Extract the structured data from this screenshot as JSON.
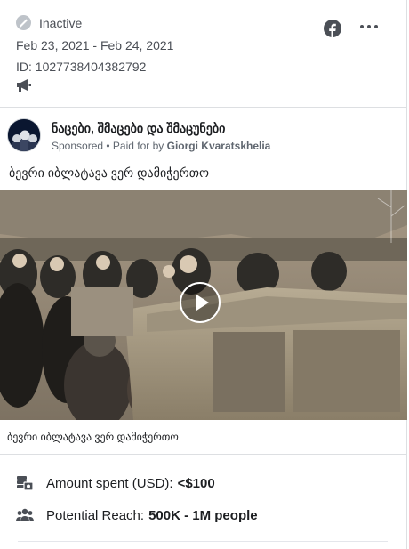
{
  "header": {
    "status": "Inactive",
    "dates": "Feb 23, 2021 - Feb 24, 2021",
    "id_label": "ID: 1027738404382792",
    "platform_icon": "facebook-icon",
    "more_icon": "more-icon"
  },
  "page": {
    "name": "ნაცები, შმაცები და შმაცუნები",
    "sponsored": "Sponsored",
    "paid_for_prefix": " • Paid for by ",
    "paid_for_by": "Giorgi Kvaratskhelia",
    "ad_text": "ბევრი იბლატავა ვერ დამიჭერთო"
  },
  "video": {
    "caption": "ბევრი იბლატავა ვერ დამიჭერთო",
    "play_icon": "play-icon"
  },
  "stats": {
    "spent_label": "Amount spent (USD):",
    "spent_value": "<$100",
    "reach_label": "Potential Reach:",
    "reach_value": "500K - 1M people"
  },
  "colors": {
    "facebook_blue": "#1877f2",
    "text_secondary": "#4b4f56",
    "divider": "#dddfe2"
  }
}
